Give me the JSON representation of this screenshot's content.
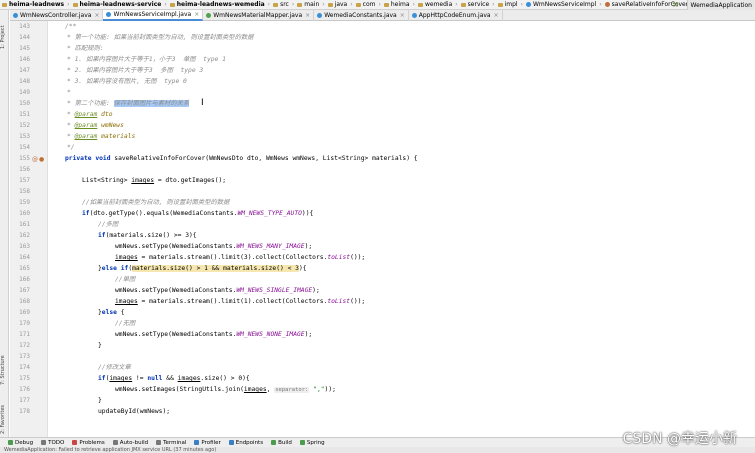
{
  "breadcrumb": [
    {
      "label": "heima-leadnews",
      "bold": true,
      "icon": "folder"
    },
    {
      "label": "heima-leadnews-service",
      "bold": true,
      "icon": "folder"
    },
    {
      "label": "heima-leadnews-wemedia",
      "bold": true,
      "icon": "folder"
    },
    {
      "label": "src",
      "bold": false,
      "icon": "folder"
    },
    {
      "label": "main",
      "bold": false,
      "icon": "folder"
    },
    {
      "label": "java",
      "bold": false,
      "icon": "folder"
    },
    {
      "label": "com",
      "bold": false,
      "icon": "folder"
    },
    {
      "label": "heima",
      "bold": false,
      "icon": "folder"
    },
    {
      "label": "wemedia",
      "bold": false,
      "icon": "folder"
    },
    {
      "label": "service",
      "bold": false,
      "icon": "folder"
    },
    {
      "label": "impl",
      "bold": false,
      "icon": "folder"
    },
    {
      "label": "WmNewsServiceImpl",
      "bold": false,
      "icon": "class"
    },
    {
      "label": "saveRelativeInfoForCover",
      "bold": false,
      "icon": "method"
    }
  ],
  "run_config": "WemediaApplication",
  "tabs": [
    {
      "label": "WmNewsController.java",
      "active": false,
      "kind": "class"
    },
    {
      "label": "WmNewsServiceImpl.java",
      "active": true,
      "kind": "class"
    },
    {
      "label": "WmNewsMaterialMapper.java",
      "active": false,
      "kind": "iface"
    },
    {
      "label": "WemediaConstants.java",
      "active": false,
      "kind": "class"
    },
    {
      "label": "AppHttpCodeEnum.java",
      "active": false,
      "kind": "class"
    }
  ],
  "left_tools": {
    "project": "1: Project",
    "structure": "7: Structure",
    "favorites": "2: Favorites"
  },
  "code_lines": [
    {
      "n": "143",
      "t": "/**",
      "y": 0
    },
    {
      "n": "144",
      "t": "",
      "y": 1
    },
    {
      "n": "145",
      "t": "",
      "y": 2
    },
    {
      "n": "146",
      "t": "",
      "y": 3
    },
    {
      "n": "147",
      "t": "",
      "y": 4
    },
    {
      "n": "148",
      "t": "",
      "y": 5
    },
    {
      "n": "149",
      "t": "",
      "y": 6
    },
    {
      "n": "150",
      "t": "",
      "y": 7
    },
    {
      "n": "151",
      "t": "",
      "y": 8
    },
    {
      "n": "152",
      "t": "",
      "y": 9
    },
    {
      "n": "153",
      "t": "",
      "y": 10
    },
    {
      "n": "154",
      "t": "",
      "y": 11
    },
    {
      "n": "155",
      "t": "",
      "y": 12
    },
    {
      "n": "156",
      "t": "",
      "y": 13
    },
    {
      "n": "157",
      "t": "",
      "y": 14
    },
    {
      "n": "158",
      "t": "",
      "y": 15
    },
    {
      "n": "159",
      "t": "",
      "y": 16
    },
    {
      "n": "160",
      "t": "",
      "y": 17
    },
    {
      "n": "161",
      "t": "",
      "y": 18
    },
    {
      "n": "162",
      "t": "",
      "y": 19
    },
    {
      "n": "163",
      "t": "",
      "y": 20
    },
    {
      "n": "164",
      "t": "",
      "y": 21
    },
    {
      "n": "165",
      "t": "",
      "y": 22
    },
    {
      "n": "166",
      "t": "",
      "y": 23
    },
    {
      "n": "167",
      "t": "",
      "y": 24
    },
    {
      "n": "168",
      "t": "",
      "y": 25
    },
    {
      "n": "169",
      "t": "",
      "y": 26
    },
    {
      "n": "170",
      "t": "",
      "y": 27
    },
    {
      "n": "171",
      "t": "",
      "y": 28
    },
    {
      "n": "172",
      "t": "",
      "y": 29
    },
    {
      "n": "173",
      "t": "",
      "y": 30
    },
    {
      "n": "174",
      "t": "",
      "y": 31
    },
    {
      "n": "175",
      "t": "",
      "y": 32
    },
    {
      "n": "176",
      "t": "",
      "y": 33
    },
    {
      "n": "177",
      "t": "",
      "y": 34
    },
    {
      "n": "178",
      "t": "",
      "y": 35
    }
  ],
  "code": {
    "c144": "* 第一个功能: 如果当前封面类型为自动, 则设置封面类型的数据",
    "c145": "* 匹配规则:",
    "c146": "* 1. 如果内容图片大于等于1，小于3  单图  type 1",
    "c147": "* 2. 如果内容图片大于等于3  多图  type 3",
    "c148": "* 3. 如果内容没有图片, 无图  type 0",
    "c149": "*",
    "c150a": "* ",
    "c150b": "第二个功能: ",
    "c150c": "保存封面图片与素材的关系",
    "c151a": "* ",
    "c151b": "@param",
    "c151c": " dto",
    "c152a": "* ",
    "c152b": "@param",
    "c152c": " wmNews",
    "c153a": "* ",
    "c153b": "@param",
    "c153c": " materials",
    "c154": "*/",
    "c155a": "private void ",
    "c155b": "saveRelativeInfoForCover(WmNewsDto dto, WmNews wmNews, List<String> materials) {",
    "c157a": "List<String> ",
    "c157b": "images",
    "c157c": " = dto.getImages();",
    "c159": "//如果当前封面类型为自动, 则设置封面类型的数据",
    "c160a": "if",
    "c160b": "(dto.getType().equals(WemediaConstants.",
    "c160c": "WM_NEWS_TYPE_AUTO",
    "c160d": ")){",
    "c161": "//多图",
    "c162a": "if",
    "c162b": "(materials.size() >= 3){",
    "c163a": "wmNews.setType(WemediaConstants.",
    "c163b": "WM_NEWS_MANY_IMAGE",
    "c163c": ");",
    "c164a": "images",
    "c164b": " = materials.stream().limit(3).collect(Collectors.",
    "c164c": "toList",
    "c164d": "());",
    "c165a": "}",
    "c165b": "else if",
    "c165c": "(",
    "c165d": "materials.size() > 1 && materials.size() < 3",
    "c165e": "){",
    "c166": "//单图",
    "c167a": "wmNews.setType(WemediaConstants.",
    "c167b": "WM_NEWS_SINGLE_IMAGE",
    "c167c": ");",
    "c168a": "images",
    "c168b": " = materials.stream().limit(1).collect(Collectors.",
    "c168c": "toList",
    "c168d": "());",
    "c169a": "}",
    "c169b": "else",
    "c169c": " {",
    "c170": "//无图",
    "c171a": "wmNews.setType(WemediaConstants.",
    "c171b": "WM_NEWS_NONE_IMAGE",
    "c171c": ");",
    "c172": "}",
    "c174": "//修改文章",
    "c175a": "if",
    "c175b": "(",
    "c175c": "images",
    "c175d": " != ",
    "c175e": "null",
    "c175f": " && ",
    "c175g": "images",
    "c175h": ".size() > 0){",
    "c176a": "wmNews.setImages(StringUtils.join(",
    "c176b": "images",
    "c176c": ", ",
    "c176d": "separator:",
    "c176e": " \",\"",
    "c176f": "));",
    "c177": "}",
    "c178": "updateById(wmNews);"
  },
  "bottom_tools": [
    {
      "label": "Debug",
      "icon": "bug-icon"
    },
    {
      "label": "TODO",
      "icon": "todo-icon"
    },
    {
      "label": "Problems",
      "icon": "problems-icon"
    },
    {
      "label": "Auto-build",
      "icon": "auto-build-icon"
    },
    {
      "label": "Terminal",
      "icon": "terminal-icon"
    },
    {
      "label": "Profiler",
      "icon": "profiler-icon"
    },
    {
      "label": "Endpoints",
      "icon": "endpoints-icon"
    },
    {
      "label": "Build",
      "icon": "build-icon"
    },
    {
      "label": "Spring",
      "icon": "spring-icon"
    }
  ],
  "status_text": "WemediaApplication: Failed to retrieve application JMX service URL (37 minutes ago)",
  "watermark": "CSDN @幸运小新",
  "colors": {
    "keyword": "#0033b3",
    "comment": "#8c8c8c",
    "field": "#871094",
    "selection": "#a6c9f5",
    "highlight": "#f6e7b0"
  }
}
